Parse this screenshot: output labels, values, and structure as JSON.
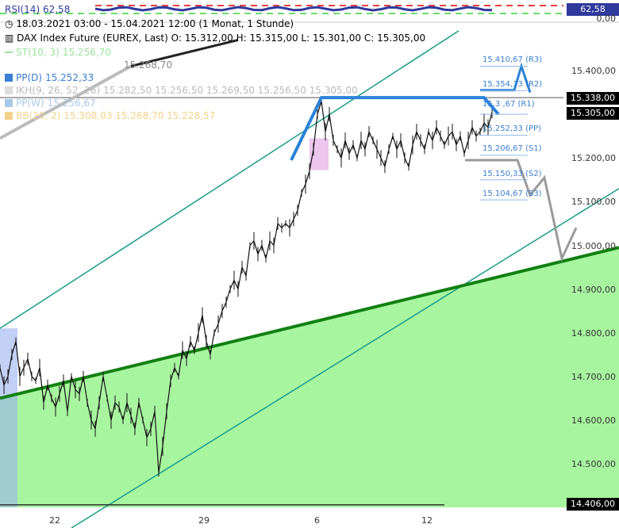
{
  "chart_data": {
    "type": "line",
    "rsi": {
      "label": "RSI(14)",
      "value": "62,58",
      "box_value": "62,58",
      "baseline_label": "0,00"
    },
    "header": {
      "date_range": "18.03.2021 03:00 - 15.04.2021 12:00",
      "period": "(1 Monat, 1 Stunde)",
      "instrument": "DAX Index Future (EUREX, Last)",
      "ohlc": "O: 15.312,00  H: 15.315,00  L: 15.301,00  C: 15.305,00"
    },
    "indicators": [
      {
        "name": "ST(10, 3)",
        "values": "15.256,70",
        "color": "#9ce49c"
      },
      {
        "name": "",
        "values": "15.268,70",
        "color": "#888888"
      },
      {
        "name": "PP(D)",
        "values": "15.252,33",
        "color": "#3a7fd5"
      },
      {
        "name": "IKH(9, 26, 52, 26)",
        "values": "15.282,50  15.256,50  15.269,50  15.256,50  15.305,00",
        "color": "#cccccc"
      },
      {
        "name": "PP(W)",
        "values": "15.256,67",
        "color": "#a8c8e8"
      },
      {
        "name": "BB(20, 2)",
        "values": "15.308,03  15.268,70  15.228,57",
        "color": "#f2d28a"
      }
    ],
    "y_ticks": [
      "15.400,00",
      "15.200,00",
      "15.100,00",
      "15.000,00",
      "14.900,00",
      "14.800,00",
      "14.700,00",
      "14.600,00",
      "14.500,00"
    ],
    "y_boxes": [
      "15.338,00",
      "15.305,00",
      "14.406,00"
    ],
    "x_ticks": [
      "22",
      "29",
      "6",
      "12"
    ],
    "pivots": [
      "15.410,67 (R3)",
      "15.354,33 (R2)",
      "15.3   ,67 (R1)",
      "15.252,33 (PP)",
      "15.206,67 (S1)",
      "15.150,33 (S2)",
      "15.104,67 (S3)"
    ],
    "ylim": [
      14380,
      15480
    ],
    "price_path": [
      [
        0,
        14720
      ],
      [
        5,
        14680
      ],
      [
        10,
        14700
      ],
      [
        15,
        14750
      ],
      [
        20,
        14780
      ],
      [
        25,
        14700
      ],
      [
        30,
        14720
      ],
      [
        35,
        14740
      ],
      [
        40,
        14700
      ],
      [
        45,
        14690
      ],
      [
        50,
        14720
      ],
      [
        55,
        14640
      ],
      [
        60,
        14680
      ],
      [
        65,
        14650
      ],
      [
        70,
        14630
      ],
      [
        75,
        14660
      ],
      [
        80,
        14690
      ],
      [
        85,
        14620
      ],
      [
        90,
        14700
      ],
      [
        95,
        14670
      ],
      [
        100,
        14660
      ],
      [
        105,
        14700
      ],
      [
        110,
        14640
      ],
      [
        115,
        14600
      ],
      [
        120,
        14580
      ],
      [
        125,
        14640
      ],
      [
        130,
        14700
      ],
      [
        135,
        14650
      ],
      [
        140,
        14600
      ],
      [
        145,
        14640
      ],
      [
        150,
        14630
      ],
      [
        155,
        14600
      ],
      [
        160,
        14640
      ],
      [
        165,
        14610
      ],
      [
        170,
        14580
      ],
      [
        175,
        14640
      ],
      [
        180,
        14600
      ],
      [
        185,
        14560
      ],
      [
        190,
        14580
      ],
      [
        195,
        14620
      ],
      [
        200,
        14480
      ],
      [
        205,
        14540
      ],
      [
        210,
        14620
      ],
      [
        215,
        14690
      ],
      [
        220,
        14720
      ],
      [
        225,
        14700
      ],
      [
        230,
        14760
      ],
      [
        235,
        14740
      ],
      [
        240,
        14780
      ],
      [
        245,
        14760
      ],
      [
        250,
        14800
      ],
      [
        255,
        14840
      ],
      [
        260,
        14780
      ],
      [
        265,
        14750
      ],
      [
        270,
        14800
      ],
      [
        275,
        14820
      ],
      [
        280,
        14850
      ],
      [
        285,
        14870
      ],
      [
        290,
        14900
      ],
      [
        295,
        14920
      ],
      [
        300,
        14900
      ],
      [
        305,
        14950
      ],
      [
        310,
        14930
      ],
      [
        315,
        15000
      ],
      [
        320,
        15010
      ],
      [
        325,
        14980
      ],
      [
        330,
        15000
      ],
      [
        335,
        14970
      ],
      [
        340,
        15010
      ],
      [
        345,
        15000
      ],
      [
        350,
        15050
      ],
      [
        355,
        15040
      ],
      [
        360,
        15050
      ],
      [
        365,
        15040
      ],
      [
        370,
        15060
      ],
      [
        375,
        15080
      ],
      [
        380,
        15120
      ],
      [
        385,
        15140
      ],
      [
        390,
        15170
      ],
      [
        395,
        15220
      ],
      [
        400,
        15300
      ],
      [
        405,
        15330
      ],
      [
        410,
        15260
      ],
      [
        415,
        15300
      ],
      [
        420,
        15240
      ],
      [
        425,
        15220
      ],
      [
        430,
        15200
      ],
      [
        435,
        15240
      ],
      [
        440,
        15210
      ],
      [
        445,
        15230
      ],
      [
        450,
        15200
      ],
      [
        455,
        15240
      ],
      [
        460,
        15220
      ],
      [
        465,
        15260
      ],
      [
        470,
        15240
      ],
      [
        475,
        15220
      ],
      [
        480,
        15200
      ],
      [
        485,
        15180
      ],
      [
        490,
        15220
      ],
      [
        495,
        15250
      ],
      [
        500,
        15220
      ],
      [
        505,
        15240
      ],
      [
        510,
        15200
      ],
      [
        515,
        15180
      ],
      [
        520,
        15230
      ],
      [
        525,
        15260
      ],
      [
        530,
        15240
      ],
      [
        535,
        15220
      ],
      [
        540,
        15260
      ],
      [
        545,
        15240
      ],
      [
        550,
        15270
      ],
      [
        555,
        15250
      ],
      [
        560,
        15230
      ],
      [
        565,
        15250
      ],
      [
        570,
        15260
      ],
      [
        575,
        15230
      ],
      [
        580,
        15250
      ],
      [
        585,
        15210
      ],
      [
        590,
        15240
      ],
      [
        595,
        15270
      ],
      [
        600,
        15250
      ],
      [
        605,
        15260
      ],
      [
        610,
        15280
      ],
      [
        615,
        15270
      ],
      [
        620,
        15305
      ]
    ],
    "colors": {
      "support_line": "#128012",
      "support_fill": "#a8f5a0",
      "channel": "#1a9a8a",
      "projection_blue": "#2a82d8",
      "projection_grey": "#9a9a9a",
      "rsi_line": "#2f3a9c"
    }
  }
}
